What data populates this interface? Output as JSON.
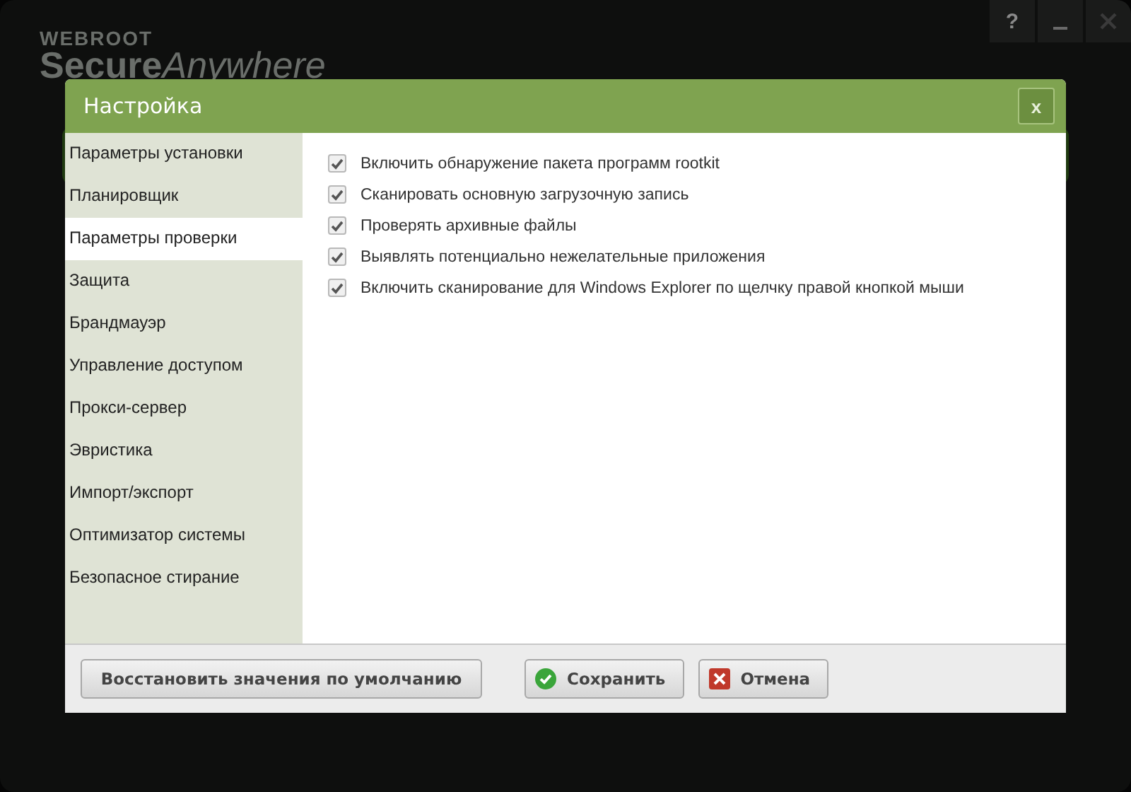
{
  "app": {
    "brand": "WEBROOT",
    "product_strong": "Secure",
    "product_light": "Anywhere",
    "help": "?"
  },
  "dialog": {
    "title": "Настройка",
    "close": "x",
    "sidebar": {
      "items": [
        {
          "label": "Параметры установки",
          "selected": false
        },
        {
          "label": "Планировщик",
          "selected": false
        },
        {
          "label": "Параметры проверки",
          "selected": true
        },
        {
          "label": "Защита",
          "selected": false
        },
        {
          "label": "Брандмауэр",
          "selected": false
        },
        {
          "label": "Управление доступом",
          "selected": false
        },
        {
          "label": "Прокси-сервер",
          "selected": false
        },
        {
          "label": "Эвристика",
          "selected": false
        },
        {
          "label": "Импорт/экспорт",
          "selected": false
        },
        {
          "label": "Оптимизатор системы",
          "selected": false
        },
        {
          "label": "Безопасное стирание",
          "selected": false
        }
      ]
    },
    "options": [
      {
        "label": "Включить обнаружение пакета программ rootkit",
        "checked": true
      },
      {
        "label": "Сканировать основную загрузочную запись",
        "checked": true
      },
      {
        "label": "Проверять архивные файлы",
        "checked": true
      },
      {
        "label": "Выявлять потенциально нежелательные приложения",
        "checked": true
      },
      {
        "label": "Включить сканирование для Windows Explorer по щелчку правой кнопкой мыши",
        "checked": true
      }
    ],
    "buttons": [
      {
        "label": "Восстановить значения по умолчанию",
        "kind": "plain"
      },
      {
        "label": "Сохранить",
        "kind": "ok"
      },
      {
        "label": "Отмена",
        "kind": "cancel"
      }
    ]
  }
}
